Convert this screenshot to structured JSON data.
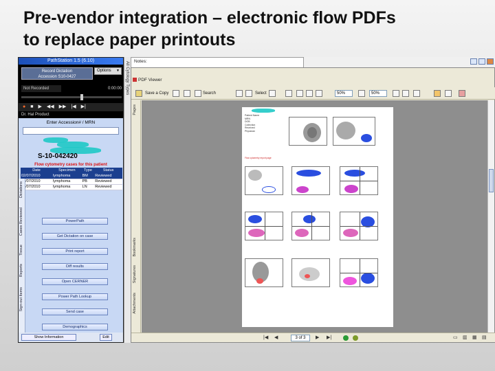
{
  "slide": {
    "title_line1": "Pre-vendor integration – electronic flow PDFs",
    "title_line2": "to replace paper printouts"
  },
  "pathstation": {
    "window_title": "PathStation 1.5 (6.10)",
    "record_button": "Record Dictation",
    "record_subline": "Accession S10-0427",
    "options_label": "Options",
    "stop_label": "Not Recorded",
    "time_readout": "0:00:00",
    "doctor_label": "Dr. Hal Product",
    "enter_label": "Enter Accession# / MRN",
    "accession_value": "",
    "case_number": "S-10-042420",
    "flow_notice": "Flow cytometry cases for this patient",
    "table": {
      "headers": [
        "Date",
        "Specimen",
        "Type",
        "Status"
      ],
      "rows": [
        [
          "02/07/2010",
          "lymphoma",
          "BM",
          "Reviewed"
        ],
        [
          "02/07/2010",
          "lymphoma",
          "PB",
          "Reviewed"
        ],
        [
          "02/07/2010",
          "lymphoma",
          "LN",
          "Reviewed"
        ]
      ]
    },
    "side_tabs": [
      "Dictations",
      "Cases Reviewed",
      "Tissue",
      "Reports",
      "Sign-out Items"
    ],
    "buttons": [
      "PowerPath",
      "Get Dictation on case",
      "Print report",
      "Diff results",
      "Open CERNER",
      "Power Path Lookup",
      "Send case",
      "Demographics"
    ],
    "show_button": "Show Information",
    "edit_button": "Edit"
  },
  "side_strip": {
    "label": "All Cytology Types"
  },
  "notes": {
    "label": "Notes:"
  },
  "pdf_viewer": {
    "title": "PDF Viewer",
    "toolbar": {
      "save_copy": "Save a Copy",
      "search": "Search",
      "select": "Select",
      "zoom_value": "50%",
      "zoom_value2": "50%"
    },
    "side_tabs": [
      "Pages",
      "Bookmarks",
      "Signatures",
      "Attachments"
    ],
    "page_indicator": "3 of 3",
    "page_header": {
      "lines": [
        "Patient Name",
        "MRN",
        "DOB",
        "Collection",
        "Received",
        "Physician"
      ],
      "caption": "Flow cytometry report page"
    }
  }
}
